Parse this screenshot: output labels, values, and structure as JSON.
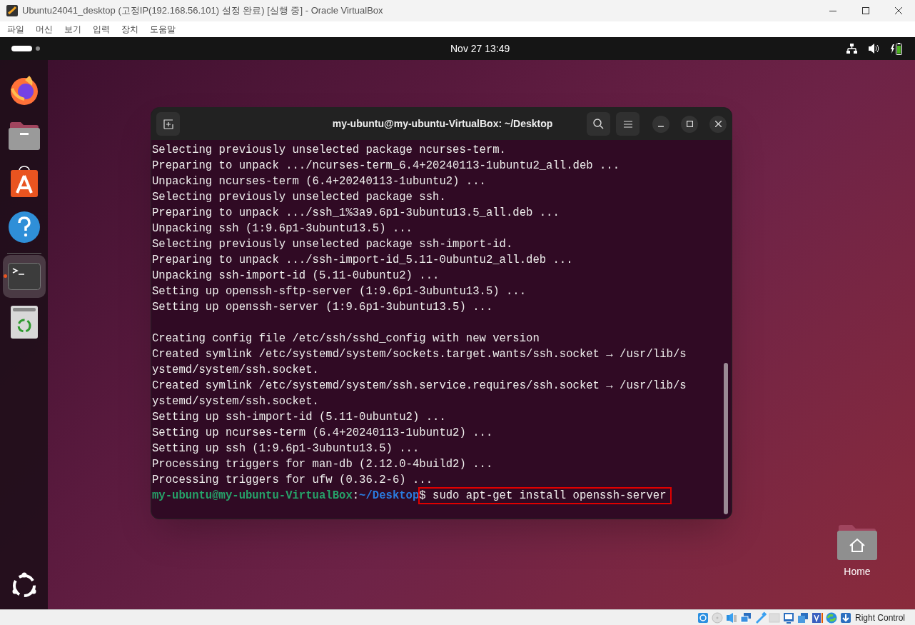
{
  "host_window": {
    "title": "Ubuntu24041_desktop (고정IP(192.168.56.101) 설정 완료) [실행 중] - Oracle VirtualBox"
  },
  "menu": [
    "파일",
    "머신",
    "보기",
    "입력",
    "장치",
    "도움말"
  ],
  "top_bar": {
    "clock": "Nov 27  13:49"
  },
  "dock": [
    {
      "kind": "firefox",
      "running": false
    },
    {
      "kind": "files",
      "running": false
    },
    {
      "kind": "store",
      "running": false
    },
    {
      "kind": "help",
      "running": false
    },
    {
      "kind": "terminal",
      "running": true
    },
    {
      "kind": "trash",
      "running": false
    }
  ],
  "terminal": {
    "title": "my-ubuntu@my-ubuntu-VirtualBox: ~/Desktop",
    "lines": [
      {
        "text": "Selecting previously unselected package ncurses-term."
      },
      {
        "text": "Preparing to unpack .../ncurses-term_6.4+20240113-1ubuntu2_all.deb ..."
      },
      {
        "text": "Unpacking ncurses-term (6.4+20240113-1ubuntu2) ..."
      },
      {
        "text": "Selecting previously unselected package ssh."
      },
      {
        "text": "Preparing to unpack .../ssh_1%3a9.6p1-3ubuntu13.5_all.deb ..."
      },
      {
        "text": "Unpacking ssh (1:9.6p1-3ubuntu13.5) ..."
      },
      {
        "text": "Selecting previously unselected package ssh-import-id."
      },
      {
        "text": "Preparing to unpack .../ssh-import-id_5.11-0ubuntu2_all.deb ..."
      },
      {
        "text": "Unpacking ssh-import-id (5.11-0ubuntu2) ..."
      },
      {
        "text": "Setting up openssh-sftp-server (1:9.6p1-3ubuntu13.5) ..."
      },
      {
        "text": "Setting up openssh-server (1:9.6p1-3ubuntu13.5) ..."
      },
      {
        "kind": "blank"
      },
      {
        "text": "Creating config file /etc/ssh/sshd_config with new version"
      },
      {
        "text": "Created symlink /etc/systemd/system/sockets.target.wants/ssh.socket → /usr/lib/s"
      },
      {
        "text": "ystemd/system/ssh.socket."
      },
      {
        "text": "Created symlink /etc/systemd/system/ssh.service.requires/ssh.socket → /usr/lib/s"
      },
      {
        "text": "ystemd/system/ssh.socket."
      },
      {
        "text": "Setting up ssh-import-id (5.11-0ubuntu2) ..."
      },
      {
        "text": "Setting up ncurses-term (6.4+20240113-1ubuntu2) ..."
      },
      {
        "text": "Setting up ssh (1:9.6p1-3ubuntu13.5) ..."
      },
      {
        "text": "Processing triggers for man-db (2.12.0-4build2) ..."
      },
      {
        "text": "Processing triggers for ufw (0.36.2-6) ..."
      }
    ],
    "prompt": {
      "user_host": "my-ubuntu@my-ubuntu-VirtualBox",
      "separator": ":",
      "path": "~/Desktop",
      "command": "$ sudo apt-get install openssh-server",
      "highlighted": true
    }
  },
  "desktop_icons": [
    {
      "label": "Home"
    }
  ],
  "status_bar": {
    "host_key": "Right Control"
  }
}
